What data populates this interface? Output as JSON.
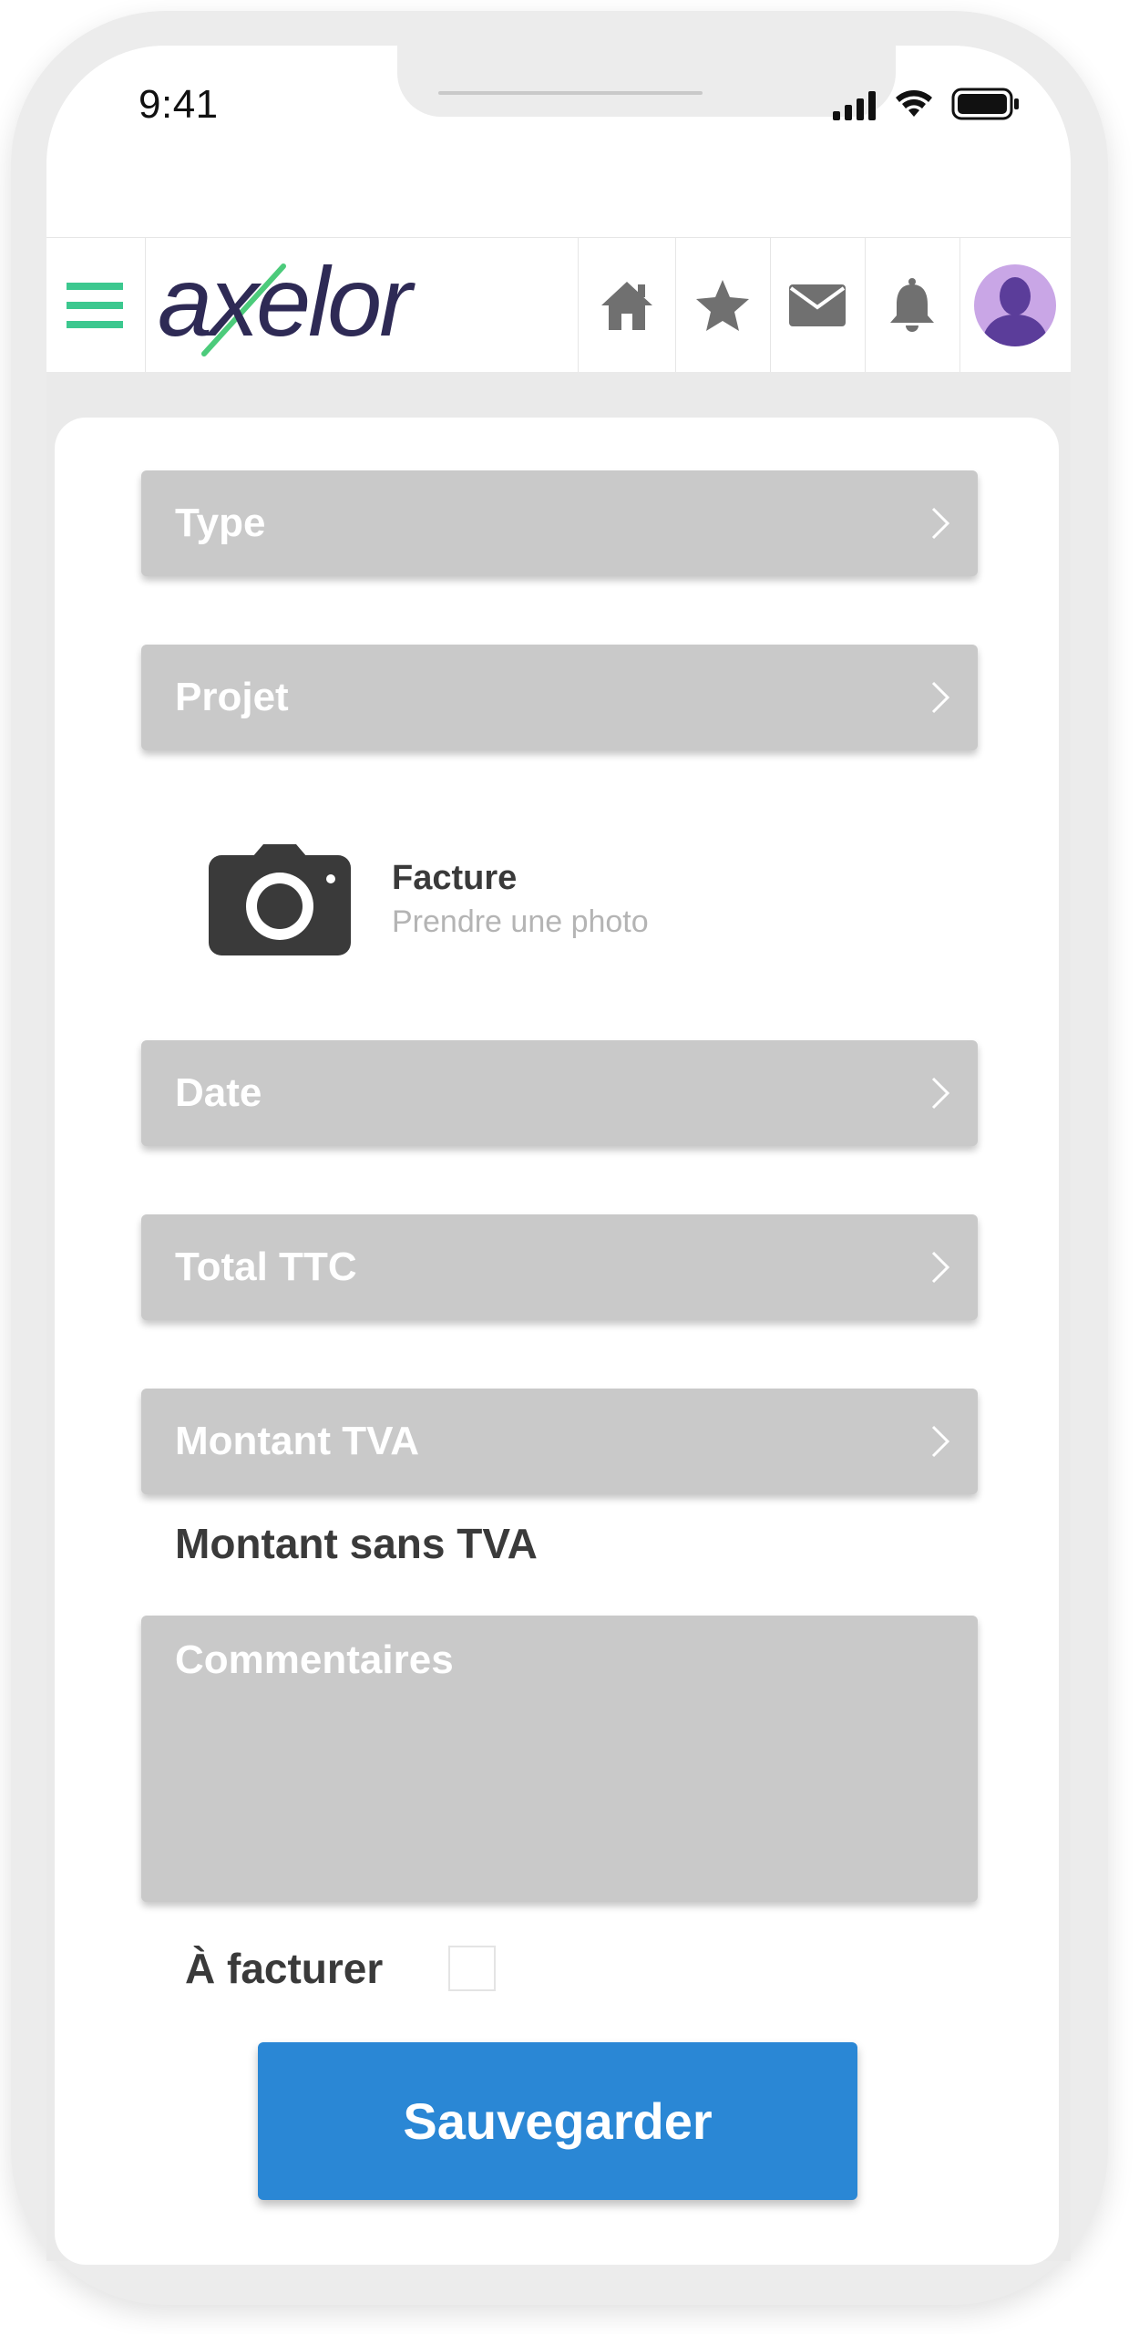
{
  "status_bar": {
    "time": "9:41"
  },
  "header": {
    "logo_text": "axelor",
    "menu_icon": "hamburger-menu-icon",
    "actions": [
      "home-icon",
      "star-icon",
      "envelope-icon",
      "bell-icon",
      "avatar"
    ],
    "colors": {
      "menu": "#3cc88f",
      "logo_text": "#2e2a55",
      "logo_accent": "#4ccb7b",
      "icons": "#707070",
      "avatar_bg": "#c9a6e6",
      "avatar_fg": "#5b3d9a"
    }
  },
  "form": {
    "fields": [
      {
        "label": "Type"
      },
      {
        "label": "Projet"
      }
    ],
    "photo": {
      "icon": "camera-icon",
      "title": "Facture",
      "subtitle": "Prendre une photo"
    },
    "fields2": [
      {
        "label": "Date"
      },
      {
        "label": "Total TTC"
      },
      {
        "label": "Montant TVA"
      }
    ],
    "amount_without_vat_label": "Montant sans TVA",
    "comments_placeholder": "Commentaires",
    "to_invoice_label": "À facturer",
    "to_invoice_checked": false,
    "save_label": "Sauvegarder",
    "colors": {
      "field_bg": "#c9c9c9",
      "save_button": "#2a87d5"
    }
  }
}
